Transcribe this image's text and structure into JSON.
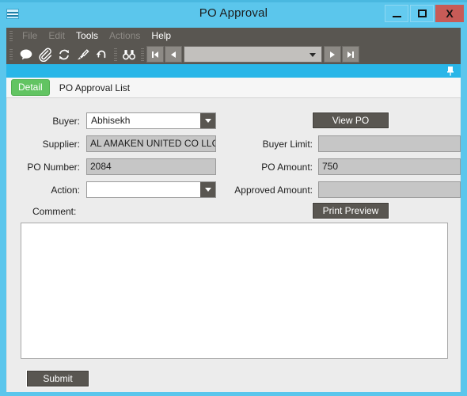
{
  "window": {
    "title": "PO Approval",
    "icon": "app-window-icon",
    "controls": {
      "minimize": "minimize-icon",
      "maximize": "maximize-icon",
      "close": "X"
    },
    "accent_color": "#5bc6ec",
    "close_color": "#c75b57"
  },
  "menubar": {
    "items": [
      {
        "label": "File",
        "enabled": false
      },
      {
        "label": "Edit",
        "enabled": false
      },
      {
        "label": "Tools",
        "enabled": true
      },
      {
        "label": "Actions",
        "enabled": false
      },
      {
        "label": "Help",
        "enabled": true
      }
    ]
  },
  "toolbar": {
    "icons": [
      "comment-icon",
      "attachment-icon",
      "refresh-icon",
      "clear-icon",
      "undo-icon",
      "find-icon"
    ],
    "nav": {
      "first": "first-record-icon",
      "previous": "previous-record-icon",
      "next": "next-record-icon",
      "last": "last-record-icon",
      "combo_value": ""
    }
  },
  "panel": {
    "pin": "pin-icon"
  },
  "tabs": [
    {
      "label": "Detail",
      "active": true,
      "color": "#62c462"
    },
    {
      "label": "PO Approval List",
      "active": false
    }
  ],
  "form": {
    "left": [
      {
        "label": "Buyer:",
        "value": "Abhisekh",
        "type": "combo",
        "readonly": false
      },
      {
        "label": "Supplier:",
        "value": "AL AMAKEN UNITED CO LLC",
        "type": "text",
        "readonly": true
      },
      {
        "label": "PO Number:",
        "value": "2084",
        "type": "text",
        "readonly": true
      },
      {
        "label": "Action:",
        "value": "",
        "type": "combo",
        "readonly": false
      }
    ],
    "right": [
      {
        "label": "Buyer Limit:",
        "value": "",
        "type": "text",
        "readonly": true
      },
      {
        "label": "PO Amount:",
        "value": "750",
        "type": "text",
        "readonly": true
      },
      {
        "label": "Approved Amount:",
        "value": "",
        "type": "text",
        "readonly": true
      }
    ],
    "buttons": {
      "view_po": "View PO",
      "print_preview": "Print Preview",
      "submit": "Submit"
    },
    "comment": {
      "label": "Comment:",
      "value": "",
      "placeholder": ""
    }
  }
}
